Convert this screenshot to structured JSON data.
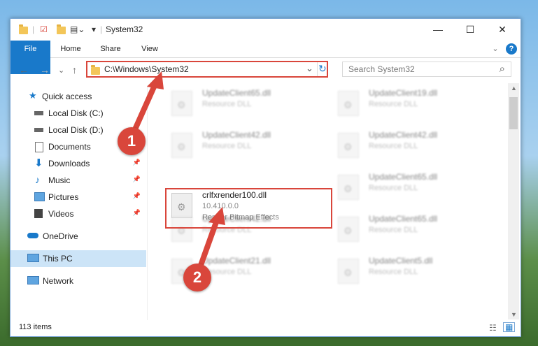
{
  "window": {
    "title": "System32",
    "minimize": "—",
    "maximize": "☐",
    "close": "✕"
  },
  "ribbon": {
    "tabs": [
      "File",
      "Home",
      "Share",
      "View"
    ],
    "help": "?",
    "expand": "⌄"
  },
  "nav": {
    "back": "←",
    "forward": "→",
    "recent": "⌄",
    "up": "↑",
    "address": "C:\\Windows\\System32",
    "dropdown": "⌄",
    "refresh": "↻",
    "search_placeholder": "Search System32",
    "search_icon": "⌕"
  },
  "sidebar": {
    "items": [
      {
        "label": "Quick access",
        "icon": "star-icon"
      },
      {
        "label": "Local Disk (C:)",
        "icon": "drive-icon",
        "pinned": true
      },
      {
        "label": "Local Disk (D:)",
        "icon": "drive-icon",
        "pinned": true
      },
      {
        "label": "Documents",
        "icon": "documents-icon",
        "pinned": true
      },
      {
        "label": "Downloads",
        "icon": "downloads-icon",
        "pinned": true
      },
      {
        "label": "Music",
        "icon": "music-icon",
        "pinned": true
      },
      {
        "label": "Pictures",
        "icon": "pictures-icon",
        "pinned": true
      },
      {
        "label": "Videos",
        "icon": "videos-icon",
        "pinned": true
      },
      {
        "label": "OneDrive",
        "icon": "cloud-icon"
      },
      {
        "label": "This PC",
        "icon": "pc-icon",
        "selected": true
      },
      {
        "label": "Network",
        "icon": "network-icon"
      }
    ],
    "pin_glyph": "📌"
  },
  "files": [
    {
      "name": "UpdateClient65.dll",
      "type": "Resource DLL"
    },
    {
      "name": "UpdateClient19.dll",
      "type": "Resource DLL"
    },
    {
      "name": "UpdateClient42.dll",
      "type": "Resource DLL"
    },
    {
      "name": "UpdateClient42.dll",
      "type": "Resource DLL"
    },
    {
      "name": "crlfxrender100.dll",
      "version": "10.410.0.0",
      "type": "Render Bitmap Effects"
    },
    {
      "name": "UpdateClient65.dll",
      "type": "Resource DLL"
    },
    {
      "name": "UpdateClient42.dll",
      "type": "Resource DLL"
    },
    {
      "name": "UpdateClient65.dll",
      "type": "Resource DLL"
    },
    {
      "name": "UpdateClient21.dll",
      "type": "Resource DLL"
    },
    {
      "name": "UpdateClient5.dll",
      "type": "Resource DLL"
    }
  ],
  "status": {
    "count": "113 items"
  },
  "annotations": {
    "step1": "1",
    "step2": "2"
  },
  "colors": {
    "accent": "#1979ca",
    "highlight": "#d9463b"
  }
}
